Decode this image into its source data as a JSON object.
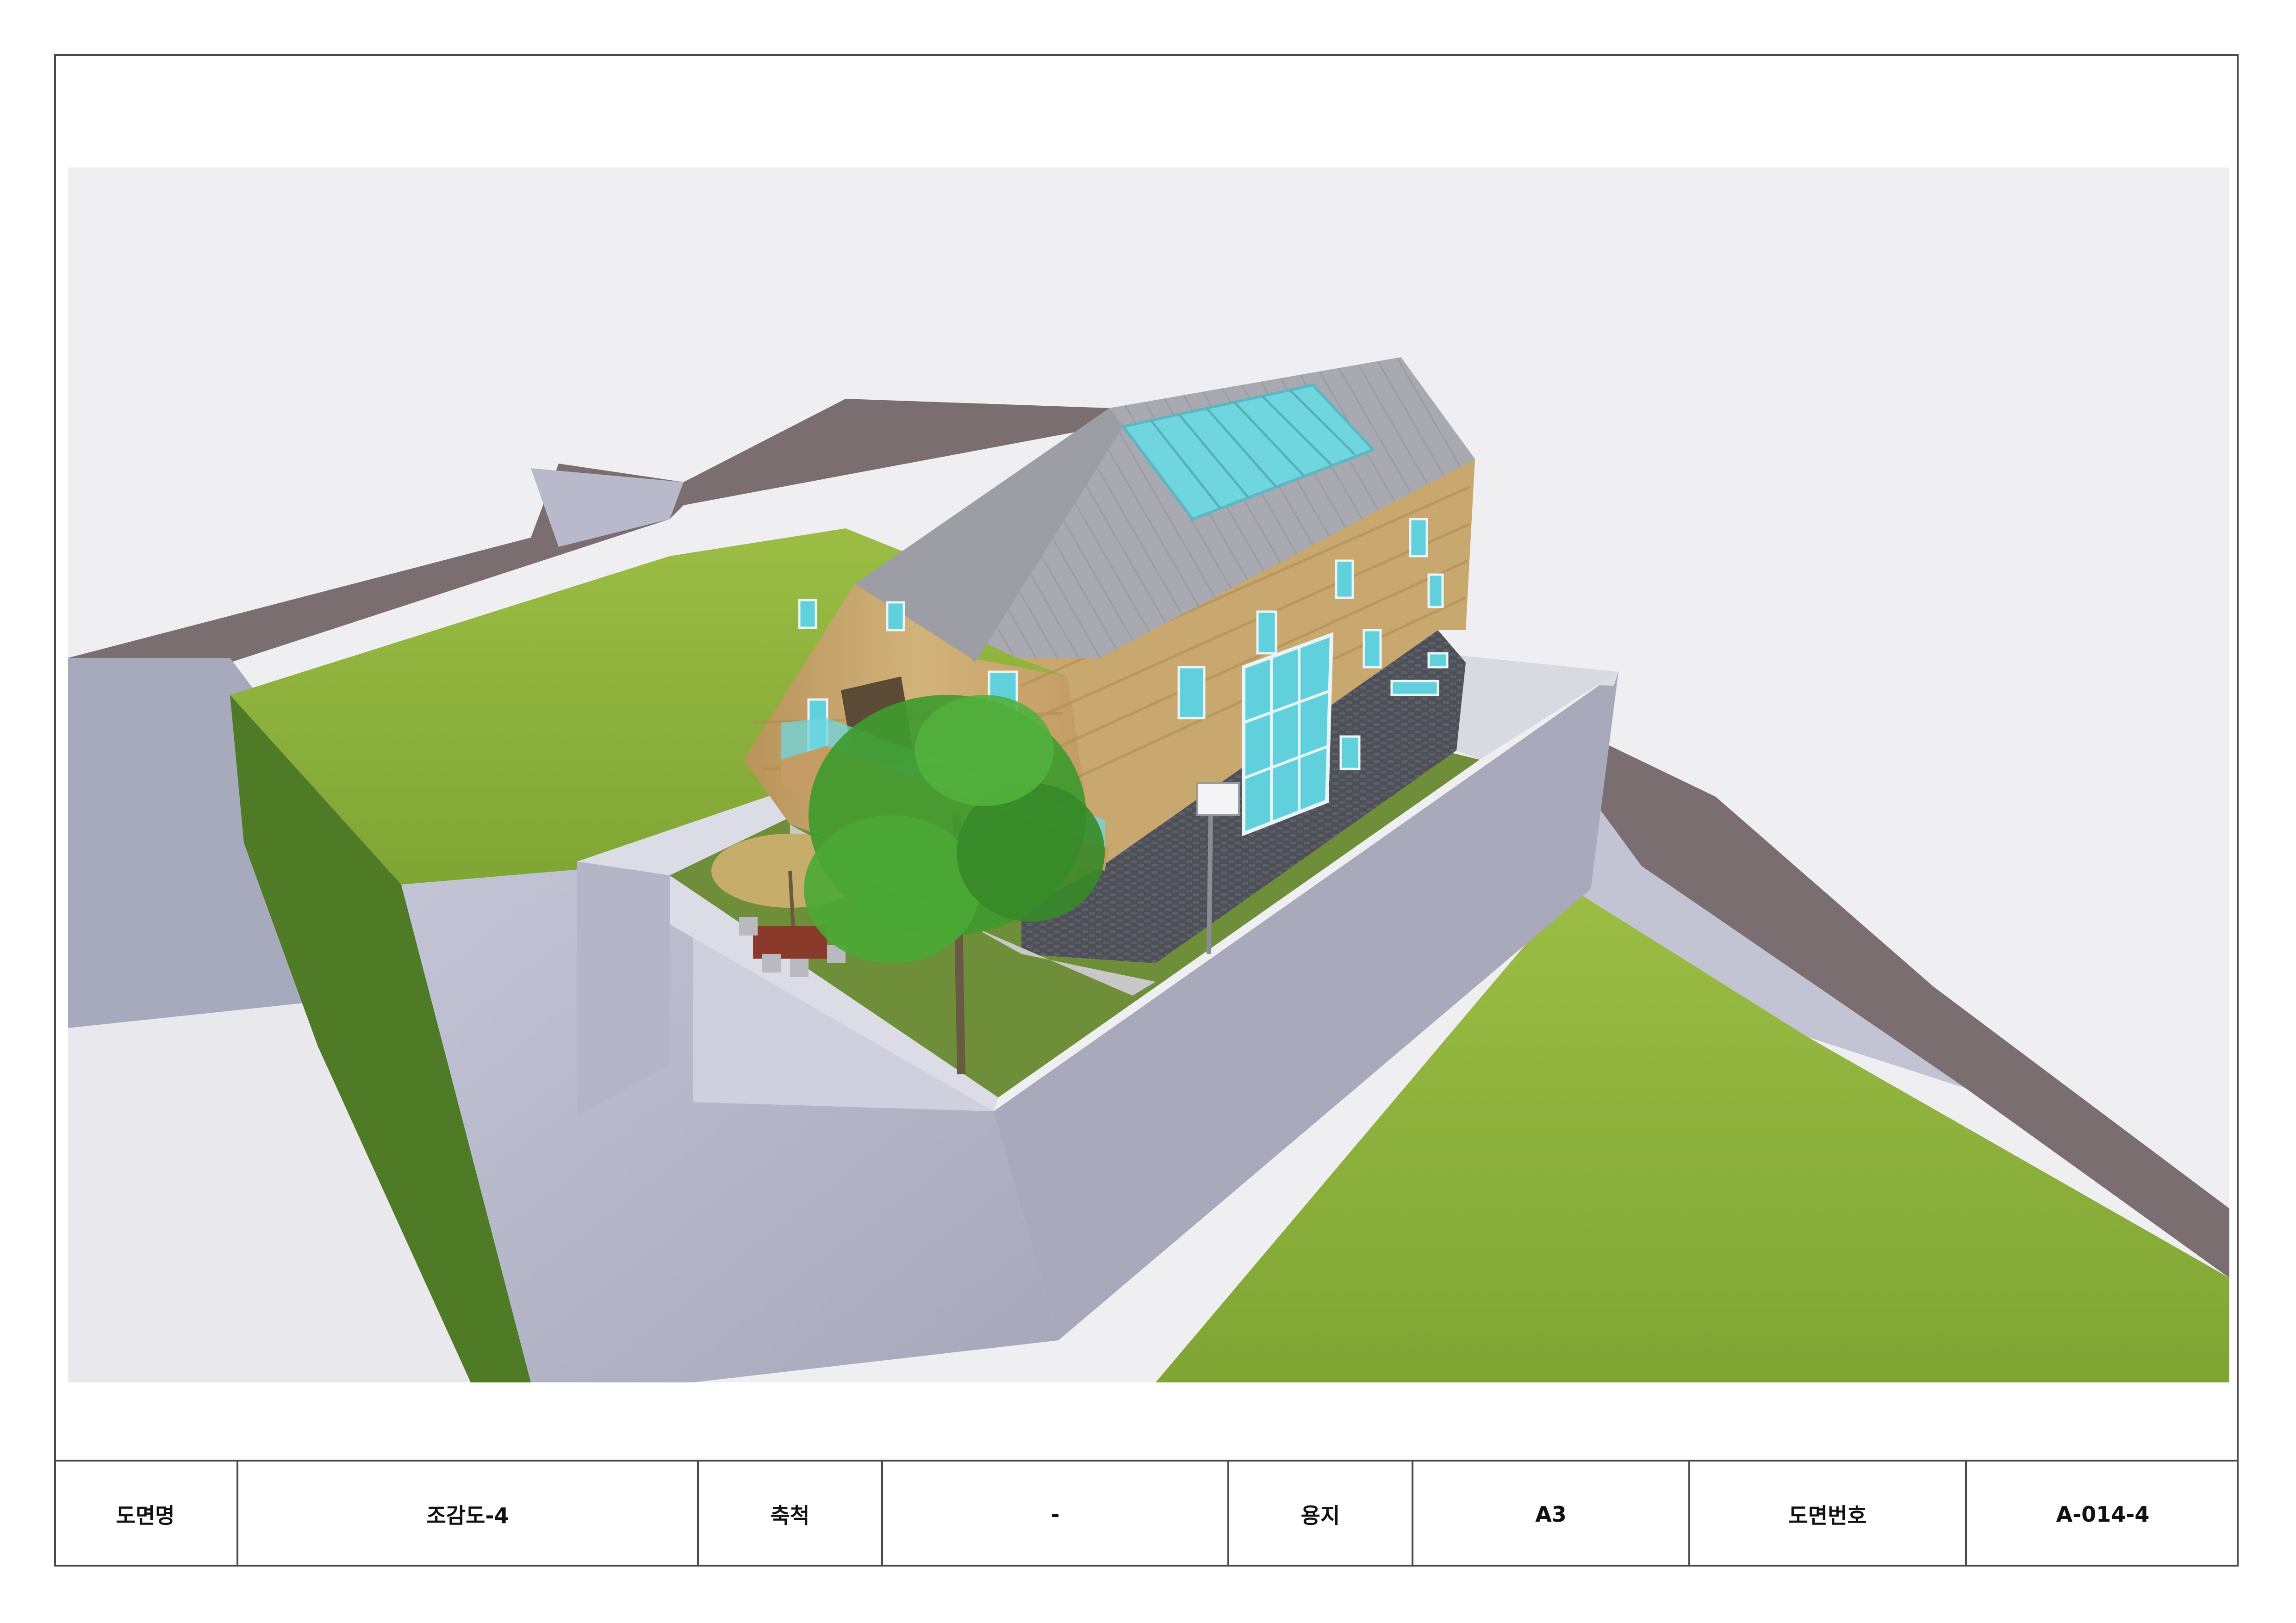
{
  "title_block": {
    "drawing_name_label": "도면명",
    "drawing_name_value": "조감도-4",
    "scale_label": "축척",
    "scale_value": "-",
    "paper_label": "용지",
    "paper_value": "A3",
    "drawing_number_label": "도면번호",
    "drawing_number_value": "A-014-4"
  },
  "colors": {
    "sky": "#efeff1",
    "lawn": "#8aae3a",
    "retaining_wall": "#b6b8cc",
    "road": "#7a6e70",
    "roof": "#a9a9b1",
    "skylight": "#6fd6e0",
    "wood_cladding": "#c9a870",
    "glass": "#5fd0dc",
    "brick_base": "#4e5058",
    "tree": "#3f9a2e",
    "umbrella": "#c6ad6a"
  }
}
